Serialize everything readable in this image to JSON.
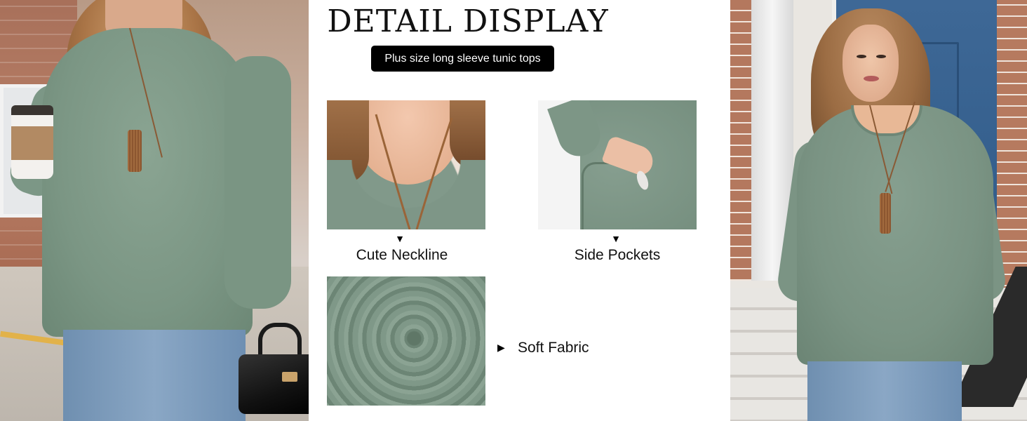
{
  "header": {
    "title": "DETAIL DISPLAY",
    "subtitle": "Plus size long sleeve tunic tops"
  },
  "details": [
    {
      "label": "Cute Neckline",
      "pointer": "▼"
    },
    {
      "label": "Side Pockets",
      "pointer": "▼"
    },
    {
      "label": "Soft Fabric",
      "pointer": "▶"
    }
  ],
  "colors": {
    "sweater": "#7b9684",
    "badge_background": "#000000",
    "badge_text": "#ffffff",
    "title_text": "#111111"
  }
}
